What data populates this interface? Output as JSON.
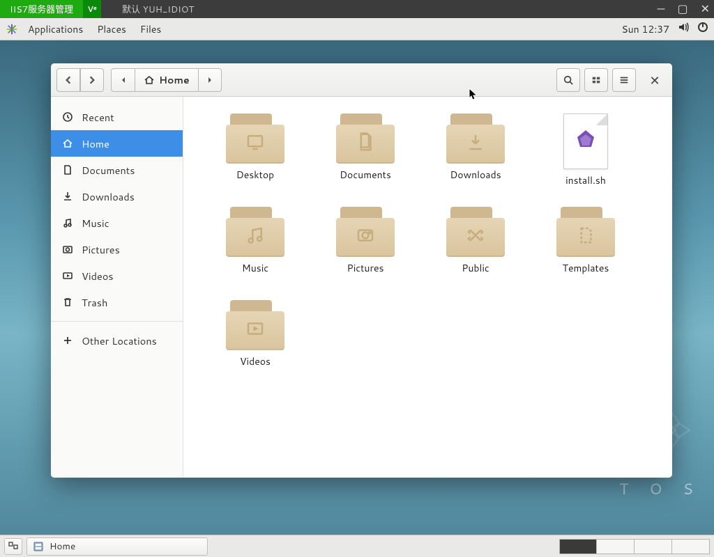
{
  "iis_bar": {
    "label": "IIS7服务器管理",
    "vnc": "V͟e",
    "title": "默认   YUH_IDIOT"
  },
  "top_panel": {
    "applications": "Applications",
    "places": "Places",
    "files": "Files",
    "clock": "Sun 12:37"
  },
  "fm": {
    "path_label": "Home",
    "sidebar": {
      "recent": "Recent",
      "home": "Home",
      "documents": "Documents",
      "downloads": "Downloads",
      "music": "Music",
      "pictures": "Pictures",
      "videos": "Videos",
      "trash": "Trash",
      "other": "Other Locations"
    },
    "items": {
      "desktop": "Desktop",
      "documents": "Documents",
      "downloads": "Downloads",
      "install": "install.sh",
      "music": "Music",
      "pictures": "Pictures",
      "public": "Public",
      "templates": "Templates",
      "videos": "Videos"
    }
  },
  "taskbar": {
    "home": "Home"
  },
  "desktop_brand": "T O S"
}
